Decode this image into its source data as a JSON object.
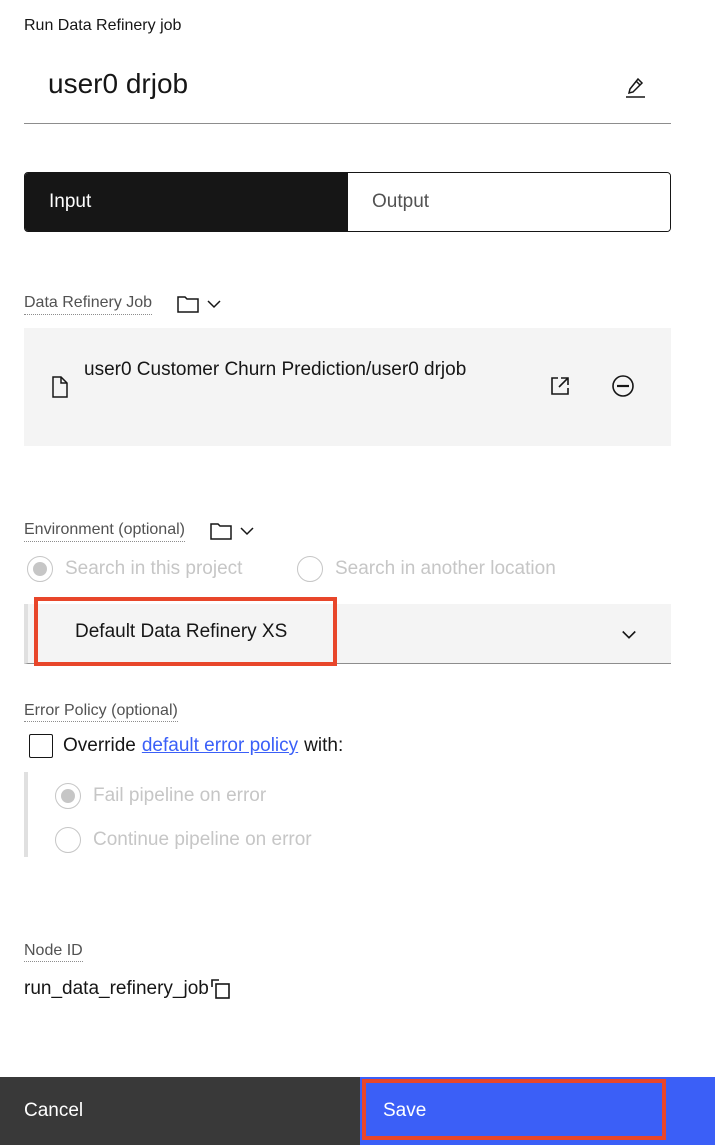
{
  "panel": {
    "heading": "Run Data Refinery job",
    "title": "user0 drjob"
  },
  "tabs": [
    {
      "label": "Input",
      "active": true
    },
    {
      "label": "Output",
      "active": false
    }
  ],
  "data_refinery_job": {
    "label": "Data Refinery Job",
    "selected_path": "user0 Customer Churn Prediction/user0 drjob"
  },
  "environment": {
    "label": "Environment (optional)",
    "radio_options": [
      {
        "label": "Search in this project",
        "selected": true,
        "disabled": true
      },
      {
        "label": "Search in another location",
        "selected": false,
        "disabled": true
      }
    ],
    "selected_value": "Default Data Refinery XS"
  },
  "error_policy": {
    "label": "Error Policy (optional)",
    "checkbox_prefix": "Override",
    "checkbox_link": "default error policy",
    "checkbox_suffix": "with:",
    "checked": false,
    "options": [
      {
        "label": "Fail pipeline on error",
        "selected": true,
        "disabled": true
      },
      {
        "label": "Continue pipeline on error",
        "selected": false,
        "disabled": true
      }
    ]
  },
  "node": {
    "label": "Node ID",
    "value": "run_data_refinery_job"
  },
  "footer": {
    "cancel_label": "Cancel",
    "save_label": "Save"
  },
  "colors": {
    "primary": "#3b5ff7",
    "highlight": "#e8462a",
    "dark": "#161616"
  }
}
